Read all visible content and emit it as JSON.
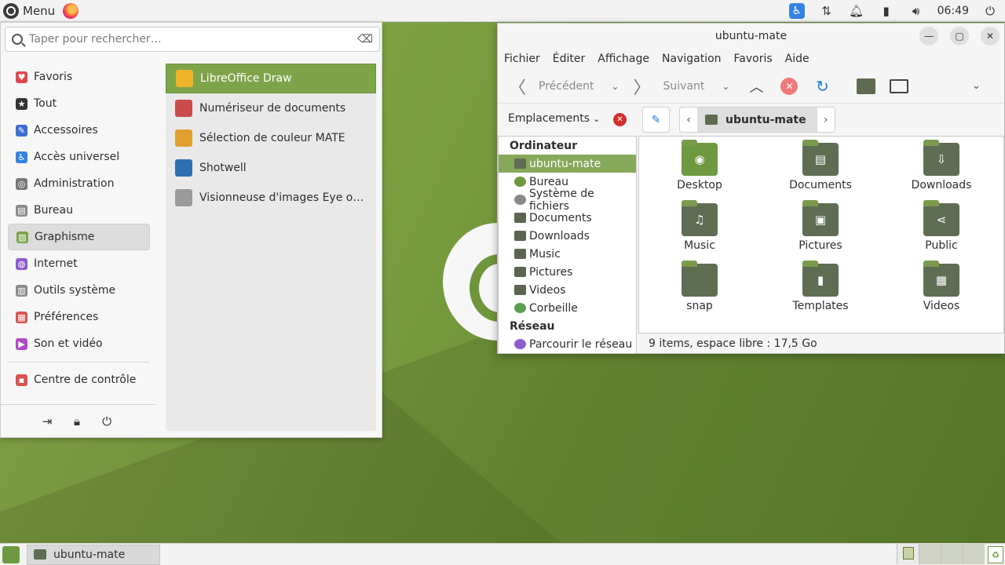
{
  "top_panel": {
    "menu_label": "Menu",
    "clock": "06:49",
    "tray_icons": [
      "accessibility-icon",
      "network-icon",
      "notification-bell-icon",
      "battery-icon",
      "volume-icon",
      "power-icon"
    ]
  },
  "menu": {
    "search_placeholder": "Taper pour rechercher…",
    "categories": [
      {
        "label": "Favoris",
        "icon": "heart-icon",
        "color": "#e0474c"
      },
      {
        "label": "Tout",
        "icon": "star-icon",
        "color": "#333333"
      },
      {
        "label": "Accessoires",
        "icon": "accessories-icon",
        "color": "#3d6fd1"
      },
      {
        "label": "Accès universel",
        "icon": "accessibility-icon",
        "color": "#3584e4"
      },
      {
        "label": "Administration",
        "icon": "admin-icon",
        "color": "#777777"
      },
      {
        "label": "Bureau",
        "icon": "office-icon",
        "color": "#8a8a8a"
      },
      {
        "label": "Graphisme",
        "icon": "graphics-icon",
        "color": "#7aa34b"
      },
      {
        "label": "Internet",
        "icon": "internet-icon",
        "color": "#8e5ccf"
      },
      {
        "label": "Outils système",
        "icon": "system-tools-icon",
        "color": "#8a8a8a"
      },
      {
        "label": "Préférences",
        "icon": "preferences-icon",
        "color": "#d9534f"
      },
      {
        "label": "Son et vidéo",
        "icon": "multimedia-icon",
        "color": "#b04ac8"
      }
    ],
    "selected_category": "Graphisme",
    "control_center": {
      "label": "Centre de contrôle",
      "icon": "control-center-icon"
    },
    "session_buttons": [
      "logout-icon",
      "lock-icon",
      "shutdown-icon"
    ],
    "apps": [
      {
        "label": "LibreOffice Draw",
        "icon": "libreoffice-draw-icon",
        "color": "#f0b429",
        "selected": true
      },
      {
        "label": "Numériseur de documents",
        "icon": "scanner-icon",
        "color": "#c94b4b"
      },
      {
        "label": "Sélection de couleur MATE",
        "icon": "color-picker-icon",
        "color": "#e0a030"
      },
      {
        "label": "Shotwell",
        "icon": "shotwell-icon",
        "color": "#2f6fb0"
      },
      {
        "label": "Visionneuse d'images Eye o…",
        "icon": "eye-of-mate-icon",
        "color": "#9a9a9a"
      }
    ]
  },
  "caja": {
    "title": "ubuntu-mate",
    "menubar": [
      "Fichier",
      "Éditer",
      "Affichage",
      "Navigation",
      "Favoris",
      "Aide"
    ],
    "toolbar": {
      "back_label": "Précédent",
      "forward_label": "Suivant"
    },
    "places_label": "Emplacements",
    "path_current": "ubuntu-mate",
    "sidebar": {
      "computer_heading": "Ordinateur",
      "computer_items": [
        {
          "label": "ubuntu-mate",
          "selected": true
        },
        {
          "label": "Bureau"
        },
        {
          "label": "Système de fichiers"
        },
        {
          "label": "Documents"
        },
        {
          "label": "Downloads"
        },
        {
          "label": "Music"
        },
        {
          "label": "Pictures"
        },
        {
          "label": "Videos"
        },
        {
          "label": "Corbeille"
        }
      ],
      "network_heading": "Réseau",
      "network_items": [
        {
          "label": "Parcourir le réseau"
        }
      ]
    },
    "files": [
      {
        "label": "Desktop",
        "icon": "desktop-folder-icon",
        "glyph": "◉"
      },
      {
        "label": "Documents",
        "icon": "documents-folder-icon",
        "glyph": "▤"
      },
      {
        "label": "Downloads",
        "icon": "downloads-folder-icon",
        "glyph": "⇩"
      },
      {
        "label": "Music",
        "icon": "music-folder-icon",
        "glyph": "♫"
      },
      {
        "label": "Pictures",
        "icon": "pictures-folder-icon",
        "glyph": "▣"
      },
      {
        "label": "Public",
        "icon": "public-folder-icon",
        "glyph": "⋖"
      },
      {
        "label": "snap",
        "icon": "folder-icon",
        "glyph": ""
      },
      {
        "label": "Templates",
        "icon": "templates-folder-icon",
        "glyph": "▮"
      },
      {
        "label": "Videos",
        "icon": "videos-folder-icon",
        "glyph": "▦"
      }
    ],
    "status": "9 items, espace libre : 17,5 Go"
  },
  "bottom_panel": {
    "task_label": "ubuntu-mate",
    "workspaces": 4
  },
  "colors": {
    "accent": "#7ea44a",
    "sidebar_selected": "#86a85a",
    "folder": "#5f6d52"
  }
}
